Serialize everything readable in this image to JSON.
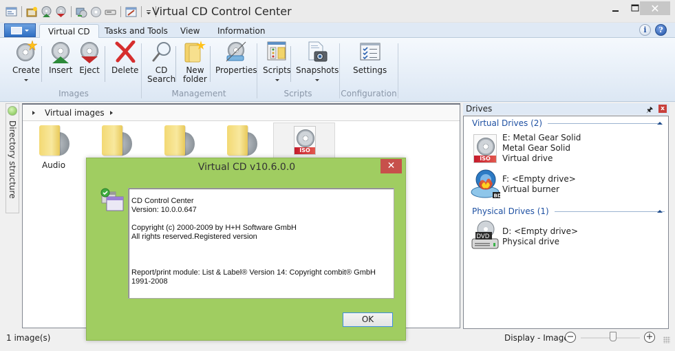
{
  "window": {
    "title": "Virtual CD Control Center",
    "controls": {
      "minimize": "–",
      "maximize": "□",
      "close": "✕"
    }
  },
  "quick_access": [
    {
      "icon": "app-window-icon"
    },
    {
      "icon": "create-image-icon"
    },
    {
      "icon": "insert-cd-icon"
    },
    {
      "icon": "eject-cd-icon"
    },
    {
      "icon": "network-icon"
    },
    {
      "icon": "cd-icon"
    },
    {
      "icon": "drive-icon"
    },
    {
      "icon": "edit-icon"
    },
    {
      "icon": "customize-dropdown-icon"
    }
  ],
  "ribbon": {
    "app_menu_icon": "app-menu-icon",
    "tabs": [
      {
        "label": "Virtual CD",
        "active": true
      },
      {
        "label": "Tasks and Tools",
        "active": false
      },
      {
        "label": "View",
        "active": false
      },
      {
        "label": "Information",
        "active": false
      }
    ],
    "help_icons": {
      "info": "i",
      "help": "?"
    },
    "groups": [
      {
        "label": "Images",
        "buttons": [
          {
            "label": "Create",
            "dropdown": true,
            "icon": "create-cd-icon"
          },
          {
            "label": "Insert",
            "dropdown": false,
            "icon": "insert-cd-icon"
          },
          {
            "label": "Eject",
            "dropdown": false,
            "icon": "eject-cd-icon"
          },
          {
            "label": "Delete",
            "dropdown": false,
            "icon": "delete-x-icon"
          }
        ]
      },
      {
        "label": "Management",
        "buttons": [
          {
            "label": "CD\nSearch",
            "line1": "CD",
            "line2": "Search",
            "icon": "magnifier-icon"
          },
          {
            "label": "New\nfolder",
            "line1": "New",
            "line2": "folder",
            "icon": "new-folder-icon"
          },
          {
            "label": "Properties",
            "icon": "properties-icon"
          }
        ]
      },
      {
        "label": "Scripts",
        "buttons": [
          {
            "label": "Scripts",
            "dropdown": true,
            "icon": "scripts-icon"
          },
          {
            "label": "Snapshots",
            "dropdown": true,
            "icon": "snapshot-camera-icon"
          }
        ]
      },
      {
        "label": "Configuration",
        "buttons": [
          {
            "label": "Settings",
            "icon": "settings-checklist-icon"
          }
        ]
      }
    ]
  },
  "side_panel": {
    "label": "Directory structure"
  },
  "main": {
    "breadcrumb": [
      "Virtual images"
    ],
    "items": [
      {
        "label": "Audio",
        "type": "folder"
      },
      {
        "label": "",
        "type": "folder"
      },
      {
        "label": "",
        "type": "folder"
      },
      {
        "label": "",
        "type": "folder"
      },
      {
        "label": "",
        "type": "iso",
        "tag": "ISO",
        "selected": true
      }
    ]
  },
  "drives": {
    "title": "Drives",
    "groups": [
      {
        "label": "Virtual Drives (2)",
        "items": [
          {
            "line1": "E: Metal Gear Solid",
            "line2": "Metal Gear Solid",
            "line3": "Virtual drive",
            "icon": "iso-drive-icon",
            "tag": "ISO"
          },
          {
            "line1": "F: <Empty drive>",
            "line2": "Virtual burner",
            "icon": "bd-burner-icon",
            "tag": "BD"
          }
        ]
      },
      {
        "label": "Physical Drives (1)",
        "items": [
          {
            "line1": "D: <Empty drive>",
            "line2": "Physical drive",
            "icon": "dvd-drive-icon",
            "tag": "DVD"
          }
        ]
      }
    ]
  },
  "statusbar": {
    "left": "1 image(s)",
    "right_label": "Display - Images",
    "zoom_out": "−",
    "zoom_in": "+",
    "zoom_level_fraction": 0.55
  },
  "dialog": {
    "title": "Virtual CD v10.6.0.0",
    "close": "✕",
    "lines": [
      "CD Control Center",
      "Version: 10.0.0.647",
      "",
      "Copyright (c) 2000-2009 by H+H Software GmbH",
      "All rights reserved.Registered version",
      "",
      "",
      "",
      "Report/print module: List & Label® Version 14: Copyright combit® GmbH",
      "1991-2008"
    ],
    "ok_label": "OK"
  }
}
